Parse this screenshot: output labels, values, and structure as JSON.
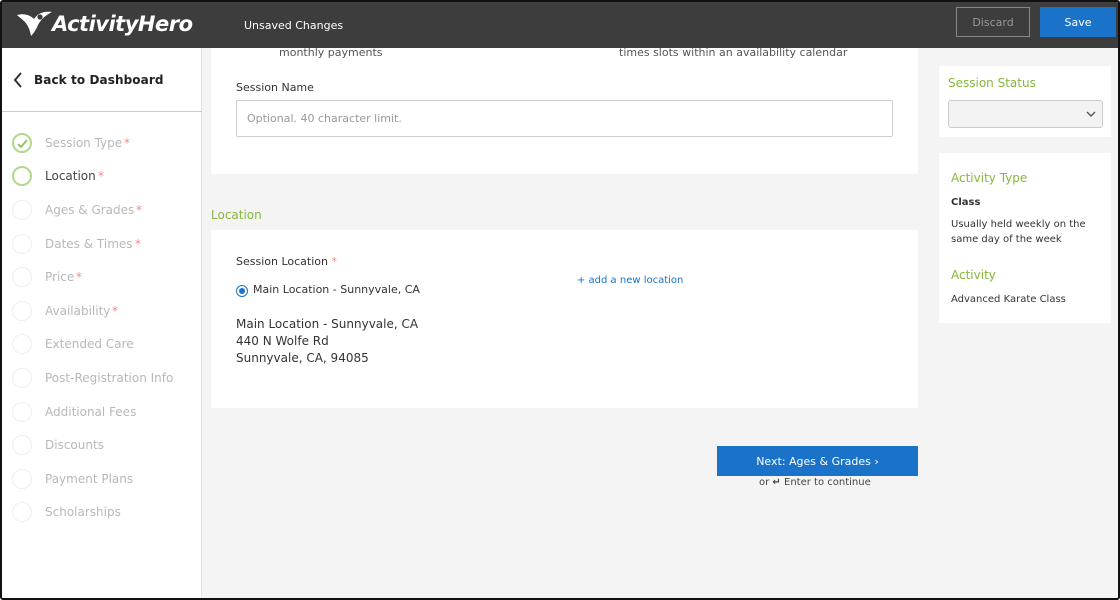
{
  "header": {
    "brand": "ActivityHero",
    "unsaved": "Unsaved Changes",
    "discard_label": "Discard",
    "save_label": "Save"
  },
  "sidebar": {
    "back_label": "Back to Dashboard",
    "steps": [
      {
        "label": "Session Type",
        "required": true,
        "state": "done"
      },
      {
        "label": "Location",
        "required": true,
        "state": "active"
      },
      {
        "label": "Ages & Grades",
        "required": true,
        "state": "pending"
      },
      {
        "label": "Dates & Times",
        "required": true,
        "state": "pending"
      },
      {
        "label": "Price",
        "required": true,
        "state": "pending"
      },
      {
        "label": "Availability",
        "required": true,
        "state": "pending"
      },
      {
        "label": "Extended Care",
        "required": false,
        "state": "pending"
      },
      {
        "label": "Post-Registration Info",
        "required": false,
        "state": "pending"
      },
      {
        "label": "Additional Fees",
        "required": false,
        "state": "pending"
      },
      {
        "label": "Discounts",
        "required": false,
        "state": "pending"
      },
      {
        "label": "Payment Plans",
        "required": false,
        "state": "pending"
      },
      {
        "label": "Scholarships",
        "required": false,
        "state": "pending"
      }
    ]
  },
  "session": {
    "cut_left": "monthly payments",
    "cut_right": "times slots within an availability calendar",
    "name_label": "Session Name",
    "name_placeholder": "Optional. 40 character limit.",
    "name_value": ""
  },
  "location": {
    "section_title": "Location",
    "field_label": "Session Location",
    "required_mark": "*",
    "selected_option": "Main Location - Sunnyvale, CA",
    "add_link": "+ add a new location",
    "address_lines": [
      "Main Location - Sunnyvale, CA",
      "440 N Wolfe Rd",
      "Sunnyvale, CA, 94085"
    ]
  },
  "footer": {
    "next_label": "Next: Ages & Grades ›",
    "hint_or": "or",
    "hint_enter": "↵",
    "hint_text": "Enter to continue"
  },
  "right": {
    "status_title": "Session Status",
    "status_value": "",
    "activity_type_title": "Activity Type",
    "activity_type_value": "Class",
    "activity_type_desc": "Usually held weekly on the same day of the week",
    "activity_title": "Activity",
    "activity_value": "Advanced Karate Class"
  },
  "colors": {
    "accent_green": "#86b83b",
    "primary_blue": "#1a73c8",
    "header_bg": "#3d3d3d"
  }
}
